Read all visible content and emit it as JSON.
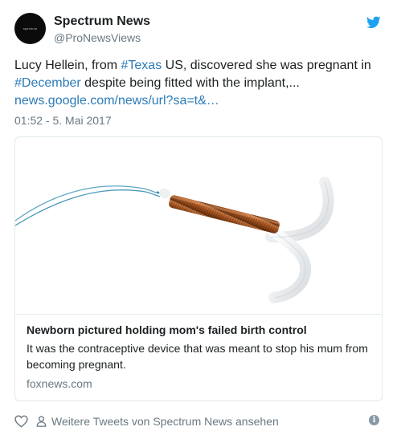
{
  "author": {
    "name": "Spectrum News",
    "handle": "@ProNewsViews",
    "avatar_text": "spectrum"
  },
  "tweet": {
    "text_start": "Lucy Hellein, from ",
    "hashtag1": "#Texas",
    "text_mid": " US, discovered she was pregnant in ",
    "hashtag2": "#December",
    "text_end": " despite being fitted with the implant,...",
    "url": "news.google.com/news/url?sa=t&…",
    "timestamp": "01:52 - 5. Mai 2017"
  },
  "card": {
    "image_icon": "iud-device-image",
    "title": "Newborn pictured holding mom's failed birth control",
    "description": "It was the contraceptive device that was meant to stop his mum from becoming pregnant.",
    "domain": "foxnews.com"
  },
  "footer": {
    "more_tweets": "Weitere Tweets von Spectrum News ansehen"
  },
  "colors": {
    "link": "#2b7bb9",
    "twitter_blue": "#1da1f2",
    "muted": "#697882",
    "border": "#e1e8ed"
  }
}
